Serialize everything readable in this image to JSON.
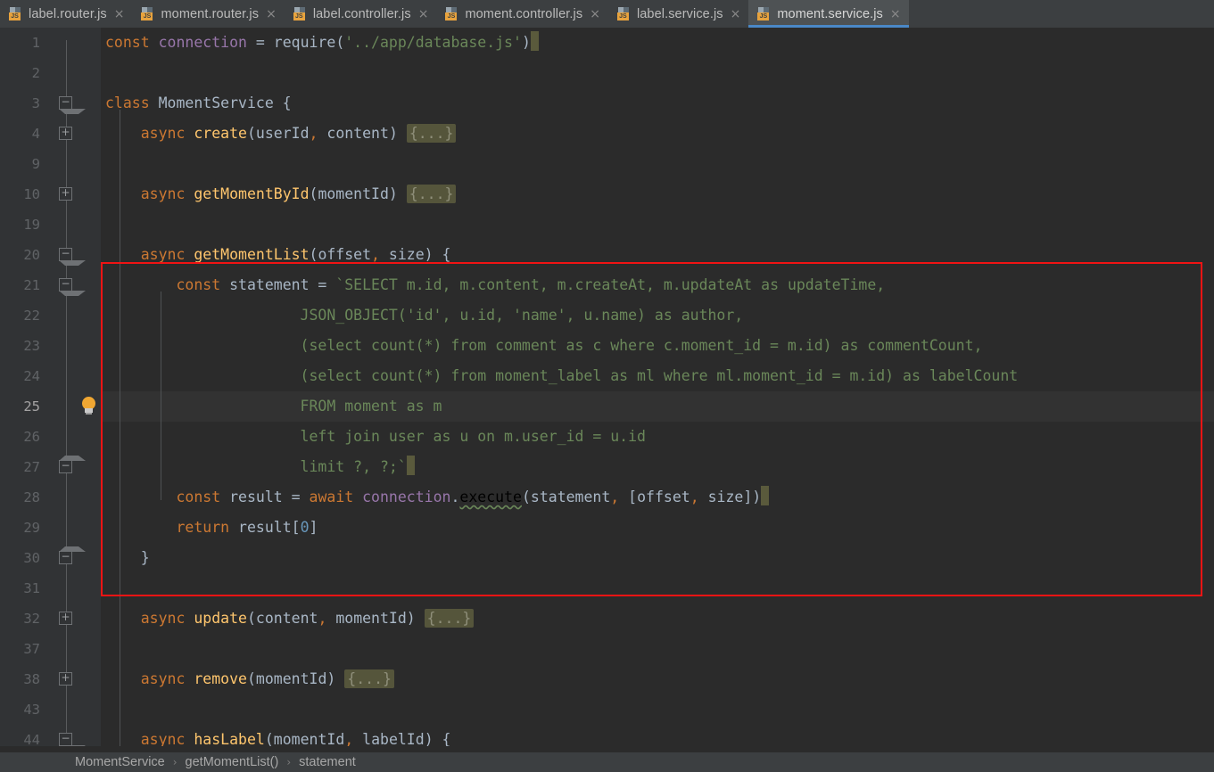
{
  "tabs": [
    {
      "label": "label.router.js",
      "icon": "js-file-icon",
      "close": "×",
      "active": false
    },
    {
      "label": "moment.router.js",
      "icon": "js-file-icon",
      "close": "×",
      "active": false
    },
    {
      "label": "label.controller.js",
      "icon": "js-file-icon",
      "close": "×",
      "active": false
    },
    {
      "label": "moment.controller.js",
      "icon": "js-file-icon",
      "close": "×",
      "active": false
    },
    {
      "label": "label.service.js",
      "icon": "js-file-icon",
      "close": "×",
      "active": false
    },
    {
      "label": "moment.service.js",
      "icon": "js-file-icon",
      "close": "×",
      "active": true
    }
  ],
  "icon_badge": "JS",
  "gutter": {
    "line_numbers": [
      "1",
      "2",
      "3",
      "4",
      "9",
      "10",
      "19",
      "20",
      "21",
      "22",
      "23",
      "24",
      "25",
      "26",
      "27",
      "28",
      "29",
      "30",
      "31",
      "32",
      "37",
      "38",
      "43",
      "44"
    ],
    "current_line_number": "25",
    "fold_markers": [
      {
        "line": "3",
        "state": "collapse-top"
      },
      {
        "line": "4",
        "state": "expand"
      },
      {
        "line": "10",
        "state": "expand"
      },
      {
        "line": "20",
        "state": "collapse-top"
      },
      {
        "line": "21",
        "state": "collapse-top"
      },
      {
        "line": "27",
        "state": "collapse-bottom"
      },
      {
        "line": "30",
        "state": "collapse-bottom"
      },
      {
        "line": "32",
        "state": "expand"
      },
      {
        "line": "38",
        "state": "expand"
      },
      {
        "line": "44",
        "state": "collapse-top"
      }
    ],
    "intention_bulb": {
      "line": "25",
      "icon": "lightbulb-icon",
      "color": "#f0a732"
    }
  },
  "code": {
    "fold_placeholder": "{...}",
    "lines": [
      {
        "n": "1",
        "segments": [
          {
            "t": "const",
            "c": "kw"
          },
          {
            "t": " ",
            "c": "ident"
          },
          {
            "t": "connection",
            "c": "local"
          },
          {
            "t": " = ",
            "c": "ident"
          },
          {
            "t": "require",
            "c": "ident"
          },
          {
            "t": "(",
            "c": "ident"
          },
          {
            "t": "'../app/database.js'",
            "c": "str"
          },
          {
            "t": ")",
            "c": "ident"
          },
          {
            "t": "CARET",
            "c": "caret"
          }
        ]
      },
      {
        "n": "2",
        "segments": []
      },
      {
        "n": "3",
        "segments": [
          {
            "t": "class",
            "c": "kw"
          },
          {
            "t": " ",
            "c": "ident"
          },
          {
            "t": "MomentService",
            "c": "cls"
          },
          {
            "t": " {",
            "c": "ident"
          }
        ]
      },
      {
        "n": "4",
        "segments": [
          {
            "t": "    ",
            "c": "ident"
          },
          {
            "t": "async",
            "c": "kw"
          },
          {
            "t": " ",
            "c": "ident"
          },
          {
            "t": "create",
            "c": "fn"
          },
          {
            "t": "(",
            "c": "ident"
          },
          {
            "t": "userId",
            "c": "param"
          },
          {
            "t": ",",
            "c": "comma"
          },
          {
            "t": " content",
            "c": "param"
          },
          {
            "t": ") ",
            "c": "ident"
          },
          {
            "t": "{...}",
            "c": "fold-ph"
          }
        ]
      },
      {
        "n": "9",
        "segments": []
      },
      {
        "n": "10",
        "segments": [
          {
            "t": "    ",
            "c": "ident"
          },
          {
            "t": "async",
            "c": "kw"
          },
          {
            "t": " ",
            "c": "ident"
          },
          {
            "t": "getMomentById",
            "c": "fn"
          },
          {
            "t": "(",
            "c": "ident"
          },
          {
            "t": "momentId",
            "c": "param"
          },
          {
            "t": ") ",
            "c": "ident"
          },
          {
            "t": "{...}",
            "c": "fold-ph"
          }
        ]
      },
      {
        "n": "19",
        "segments": []
      },
      {
        "n": "20",
        "segments": [
          {
            "t": "    ",
            "c": "ident"
          },
          {
            "t": "async",
            "c": "kw"
          },
          {
            "t": " ",
            "c": "ident"
          },
          {
            "t": "getMomentList",
            "c": "fn"
          },
          {
            "t": "(",
            "c": "ident"
          },
          {
            "t": "offset",
            "c": "param"
          },
          {
            "t": ",",
            "c": "comma"
          },
          {
            "t": " size",
            "c": "param"
          },
          {
            "t": ") {",
            "c": "ident"
          }
        ]
      },
      {
        "n": "21",
        "segments": [
          {
            "t": "        ",
            "c": "ident"
          },
          {
            "t": "const",
            "c": "kw"
          },
          {
            "t": " ",
            "c": "ident"
          },
          {
            "t": "statement",
            "c": "ident"
          },
          {
            "t": " = ",
            "c": "ident"
          },
          {
            "t": "`SELECT m.id, m.content, m.createAt, m.updateAt as updateTime,",
            "c": "str"
          }
        ]
      },
      {
        "n": "22",
        "segments": [
          {
            "t": "                      JSON_OBJECT('id', u.id, 'name', u.name) as author,",
            "c": "str"
          }
        ]
      },
      {
        "n": "23",
        "segments": [
          {
            "t": "                      (select count(*) from comment as c where c.moment_id = m.id) as commentCount,",
            "c": "str"
          }
        ]
      },
      {
        "n": "24",
        "segments": [
          {
            "t": "                      (select count(*) from moment_label as ml where ml.moment_id = m.id) as labelCount",
            "c": "str"
          }
        ]
      },
      {
        "n": "25",
        "segments": [
          {
            "t": "                      FROM moment as m",
            "c": "str"
          }
        ]
      },
      {
        "n": "26",
        "segments": [
          {
            "t": "                      left join user as u on m.user_id = u.id",
            "c": "str"
          }
        ]
      },
      {
        "n": "27",
        "segments": [
          {
            "t": "                      limit ?, ?;`",
            "c": "str"
          },
          {
            "t": "CARET",
            "c": "caret"
          }
        ]
      },
      {
        "n": "28",
        "segments": [
          {
            "t": "        ",
            "c": "ident"
          },
          {
            "t": "const",
            "c": "kw"
          },
          {
            "t": " ",
            "c": "ident"
          },
          {
            "t": "result",
            "c": "ident"
          },
          {
            "t": " = ",
            "c": "ident"
          },
          {
            "t": "await",
            "c": "kw"
          },
          {
            "t": " ",
            "c": "ident"
          },
          {
            "t": "connection",
            "c": "local"
          },
          {
            "t": ".",
            "c": "ident"
          },
          {
            "t": "execute",
            "c": "squiggle"
          },
          {
            "t": "(",
            "c": "ident"
          },
          {
            "t": "statement",
            "c": "ident"
          },
          {
            "t": ",",
            "c": "comma"
          },
          {
            "t": " [offset",
            "c": "ident"
          },
          {
            "t": ",",
            "c": "comma"
          },
          {
            "t": " size])",
            "c": "ident"
          },
          {
            "t": "CARET",
            "c": "caret"
          }
        ]
      },
      {
        "n": "29",
        "segments": [
          {
            "t": "        ",
            "c": "ident"
          },
          {
            "t": "return",
            "c": "kw"
          },
          {
            "t": " result[",
            "c": "ident"
          },
          {
            "t": "0",
            "c": "num"
          },
          {
            "t": "]",
            "c": "ident"
          }
        ]
      },
      {
        "n": "30",
        "segments": [
          {
            "t": "    }",
            "c": "ident"
          }
        ]
      },
      {
        "n": "31",
        "segments": []
      },
      {
        "n": "32",
        "segments": [
          {
            "t": "    ",
            "c": "ident"
          },
          {
            "t": "async",
            "c": "kw"
          },
          {
            "t": " ",
            "c": "ident"
          },
          {
            "t": "update",
            "c": "fn"
          },
          {
            "t": "(",
            "c": "ident"
          },
          {
            "t": "content",
            "c": "param"
          },
          {
            "t": ",",
            "c": "comma"
          },
          {
            "t": " momentId",
            "c": "param"
          },
          {
            "t": ") ",
            "c": "ident"
          },
          {
            "t": "{...}",
            "c": "fold-ph"
          }
        ]
      },
      {
        "n": "37",
        "segments": []
      },
      {
        "n": "38",
        "segments": [
          {
            "t": "    ",
            "c": "ident"
          },
          {
            "t": "async",
            "c": "kw"
          },
          {
            "t": " ",
            "c": "ident"
          },
          {
            "t": "remove",
            "c": "fn"
          },
          {
            "t": "(",
            "c": "ident"
          },
          {
            "t": "momentId",
            "c": "param"
          },
          {
            "t": ") ",
            "c": "ident"
          },
          {
            "t": "{...}",
            "c": "fold-ph"
          }
        ]
      },
      {
        "n": "43",
        "segments": []
      },
      {
        "n": "44",
        "segments": [
          {
            "t": "    ",
            "c": "ident"
          },
          {
            "t": "async",
            "c": "kw"
          },
          {
            "t": " ",
            "c": "ident"
          },
          {
            "t": "hasLabel",
            "c": "fn"
          },
          {
            "t": "(",
            "c": "ident"
          },
          {
            "t": "momentId",
            "c": "param"
          },
          {
            "t": ",",
            "c": "comma"
          },
          {
            "t": " labelId",
            "c": "param"
          },
          {
            "t": ") {",
            "c": "ident"
          }
        ]
      }
    ]
  },
  "annotation": {
    "shape": "rectangle",
    "color": "#f01414",
    "covers_lines": [
      "20",
      "21",
      "22",
      "23",
      "24",
      "25",
      "26",
      "27",
      "28",
      "29",
      "30"
    ]
  },
  "breadcrumb": {
    "separator": "›",
    "items": [
      "MomentService",
      "getMomentList()",
      "statement"
    ]
  },
  "colors": {
    "editor_background": "#2b2b2b",
    "gutter_background": "#313335",
    "tabbar_background": "#3c3f41",
    "active_tab_background": "#4e5254",
    "active_tab_underline": "#4a88c7",
    "current_line_background": "#323232",
    "keyword": "#cc7832",
    "string": "#6a8759",
    "function_name": "#ffc66d",
    "identifier": "#a9b7c6",
    "local_variable": "#9876aa",
    "number": "#6897bb",
    "fold_placeholder": "#55553b",
    "annotation_red": "#f01414",
    "scrollbar_thumb": "#5a5a3c"
  },
  "scrollbar": {
    "name": "horizontal-scrollbar-thumb"
  }
}
